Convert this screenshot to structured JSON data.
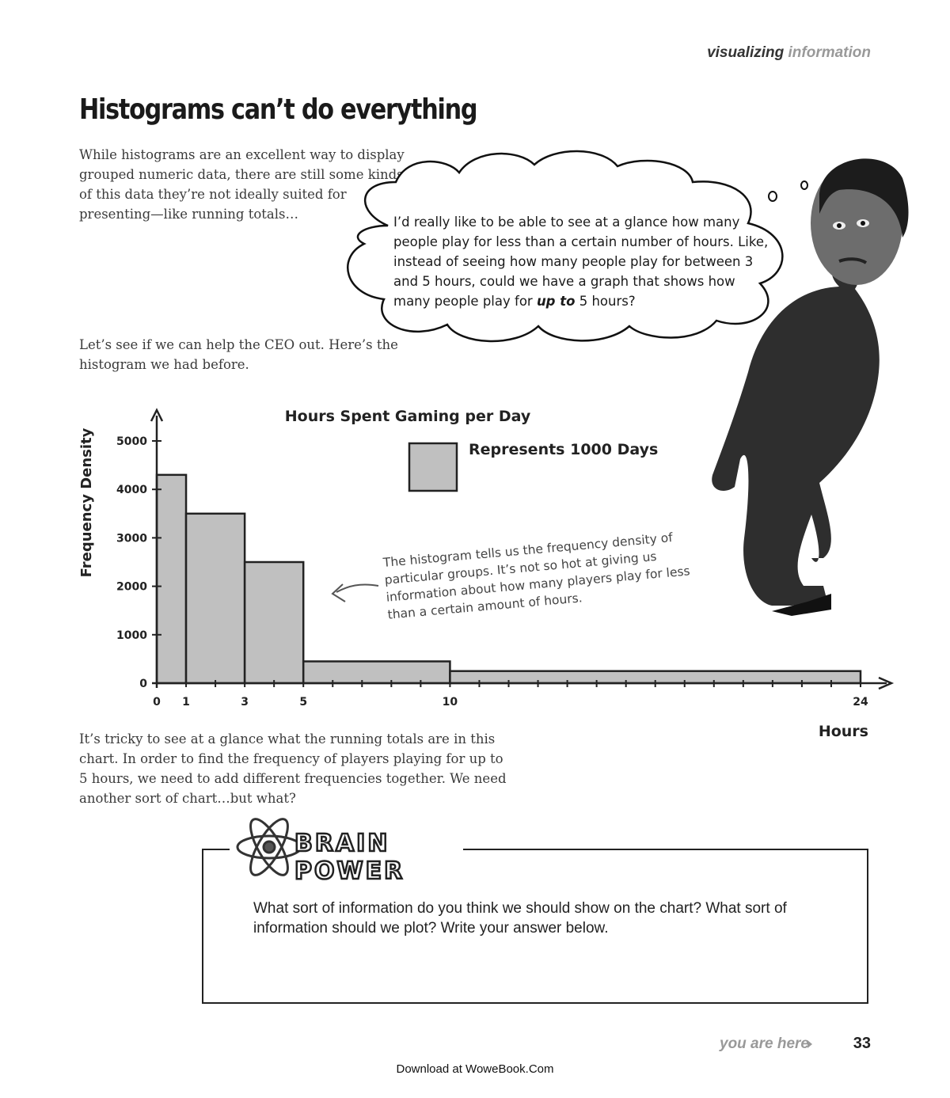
{
  "header": {
    "section_bold": "visualizing",
    "section_light": "information"
  },
  "title": "Histograms can’t do everything",
  "intro": "While histograms are an excellent way to display grouped numeric data, there are still some kinds of this data they’re not ideally suited for presenting—like running totals…",
  "bubble": {
    "before": "I’d really like to be able to see at a glance how many people play for less than a certain number of hours. Like, instead of seeing how many people play for between 3 and 5 hours, could we have a graph that shows how many people play for ",
    "emphasis": "up to",
    "after": " 5 hours?"
  },
  "lead_in": "Let’s see if we can help the CEO out. Here’s the histogram we had before.",
  "chart_data": {
    "type": "bar",
    "title": "Hours Spent Gaming per Day",
    "xlabel": "Hours",
    "ylabel": "Frequency Density",
    "legend": {
      "label": "Represents 1000 Days",
      "placement": "top-right"
    },
    "xlim": [
      0,
      24
    ],
    "ylim": [
      0,
      5000
    ],
    "x_ticks": [
      0,
      1,
      3,
      5,
      10,
      24
    ],
    "y_ticks": [
      0,
      1000,
      2000,
      3000,
      4000,
      5000
    ],
    "bins": [
      {
        "start": 0,
        "end": 1,
        "value": 4300
      },
      {
        "start": 1,
        "end": 3,
        "value": 3500
      },
      {
        "start": 3,
        "end": 5,
        "value": 2500
      },
      {
        "start": 5,
        "end": 10,
        "value": 450
      },
      {
        "start": 10,
        "end": 24,
        "value": 250
      }
    ],
    "bar_color": "#c0c0c0",
    "grid": false
  },
  "annotation": "The histogram tells us the frequency density of particular groups. It’s not so hot at giving us information about how many players play for less than a certain amount of hours.",
  "followup": "It’s tricky to see at a glance what the running totals are in this chart. In order to find the frequency of players playing for up to 5 hours, we need to add different frequencies together. We need another sort of chart…but what?",
  "brain_power": {
    "heading_line1": "BRAIN",
    "heading_line2": "POWER",
    "prompt": "What sort of information do you think we should show on the chart? What sort of information should we plot? Write your answer below."
  },
  "footer": {
    "you_are_here": "you are here",
    "page_number": "33",
    "download": "Download at WoweBook.Com"
  },
  "icons": [
    "thought-bubble-icon",
    "person-figure-icon",
    "atom-icon",
    "curved-arrow-icon",
    "triangle-arrow-icon"
  ]
}
